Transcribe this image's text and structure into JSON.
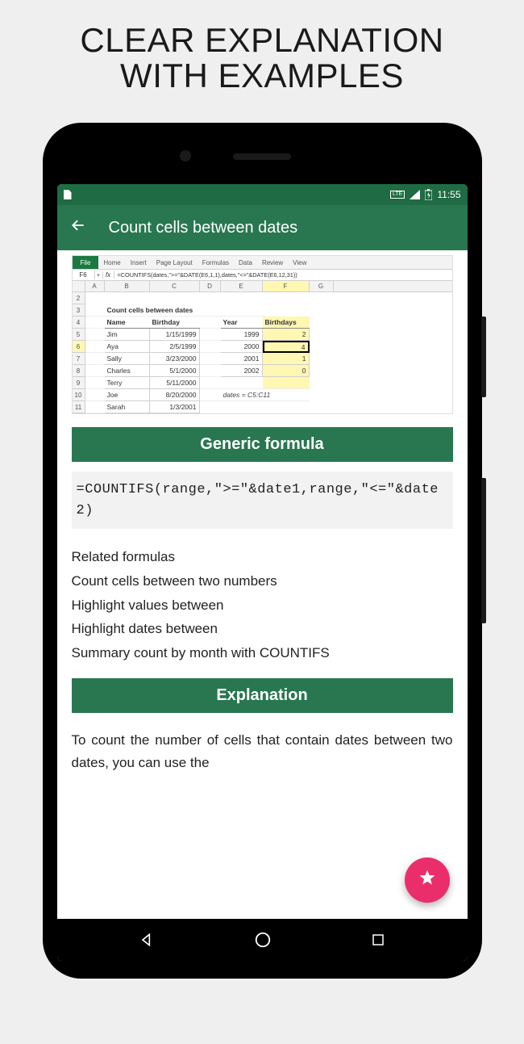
{
  "marketing": {
    "line1": "CLEAR EXPLANATION",
    "line2": "WITH EXAMPLES"
  },
  "status": {
    "lte": "LTE",
    "time": "11:55"
  },
  "appbar": {
    "title": "Count cells between dates"
  },
  "excel": {
    "tabs": {
      "file": "File",
      "home": "Home",
      "insert": "Insert",
      "pagelayout": "Page Layout",
      "formulas": "Formulas",
      "data": "Data",
      "review": "Review",
      "view": "View"
    },
    "active_cell": "F6",
    "dropdown": "▾",
    "fx": "fx",
    "formula": "=COUNTIFS(dates,\">=\"&DATE(E6,1,1),dates,\"<=\"&DATE(E6,12,31))",
    "cols": {
      "A": "A",
      "B": "B",
      "C": "C",
      "D": "D",
      "E": "E",
      "F": "F",
      "G": "G"
    },
    "title": "Count cells between dates",
    "left_headers": {
      "name": "Name",
      "birthday": "Birthday"
    },
    "left_rows": [
      {
        "n": "5",
        "name": "Jim",
        "bd": "1/15/1999"
      },
      {
        "n": "6",
        "name": "Aya",
        "bd": "2/5/1999"
      },
      {
        "n": "7",
        "name": "Sally",
        "bd": "3/23/2000"
      },
      {
        "n": "8",
        "name": "Charles",
        "bd": "5/1/2000"
      },
      {
        "n": "9",
        "name": "Terry",
        "bd": "5/11/2000"
      },
      {
        "n": "10",
        "name": "Joe",
        "bd": "8/20/2000"
      },
      {
        "n": "11",
        "name": "Sarah",
        "bd": "1/3/2001"
      }
    ],
    "right_headers": {
      "year": "Year",
      "birthdays": "Birthdays"
    },
    "right_rows": [
      {
        "year": "1999",
        "count": "2"
      },
      {
        "year": "2000",
        "count": "4"
      },
      {
        "year": "2001",
        "count": "1"
      },
      {
        "year": "2002",
        "count": "0"
      }
    ],
    "range_note": "dates = C5:C11",
    "row_nums": {
      "r2": "2",
      "r3": "3",
      "r4": "4"
    }
  },
  "sections": {
    "generic_formula": "Generic formula",
    "explanation": "Explanation"
  },
  "code": "=COUNTIFS(range,\">=\"&date1,range,\"<=\"&date2)",
  "related": {
    "heading": "Related formulas",
    "items": [
      "Count cells between two numbers",
      "Highlight values between",
      "Highlight dates between",
      "Summary count by month with COUNTIFS"
    ]
  },
  "explanation_text": "To count the number of cells that contain dates between two dates, you can use the"
}
